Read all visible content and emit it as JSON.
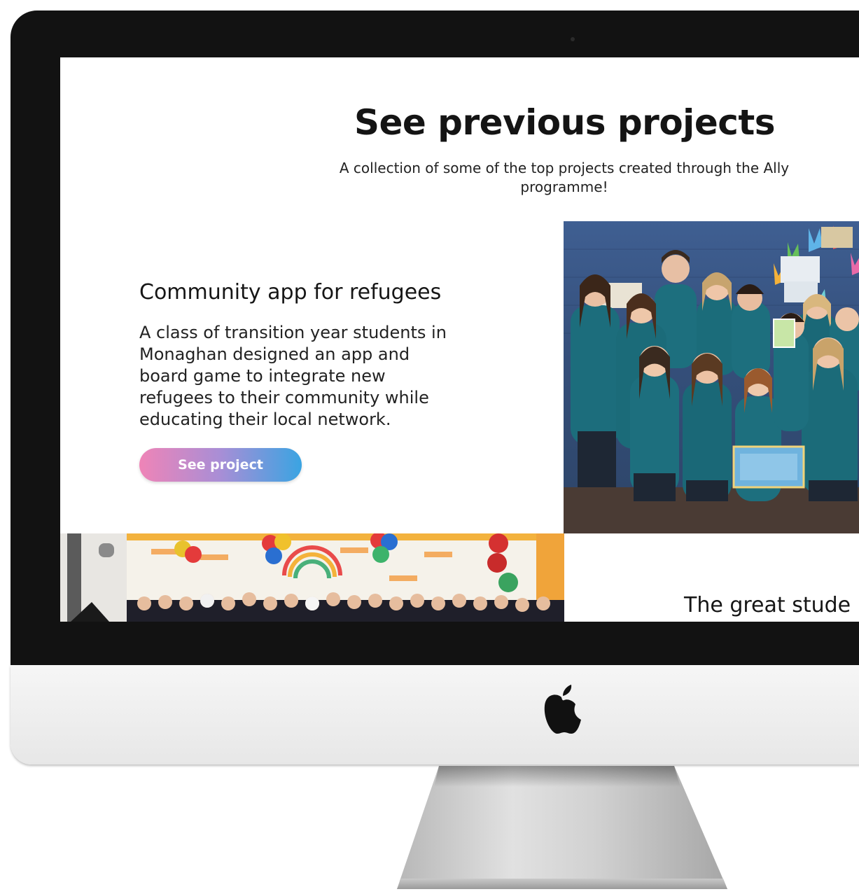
{
  "section": {
    "title": "See previous projects",
    "subtitle": "A collection of some of the top projects created through the Ally programme!"
  },
  "project": {
    "heading": "Community app for refugees",
    "description": "A class of transition year students in Monaghan designed an app and board game to integrate new refugees to their community while educating their local network.",
    "cta_label": "See project"
  },
  "next_project": {
    "heading_partial": "The great stude"
  },
  "colors": {
    "button_gradient_start": "#ef84b7",
    "button_gradient_end": "#3aa4e2",
    "uniform": "#1d6f7e",
    "bezel": "#121212"
  },
  "icons": [
    "apple-logo-icon",
    "camera-icon"
  ]
}
